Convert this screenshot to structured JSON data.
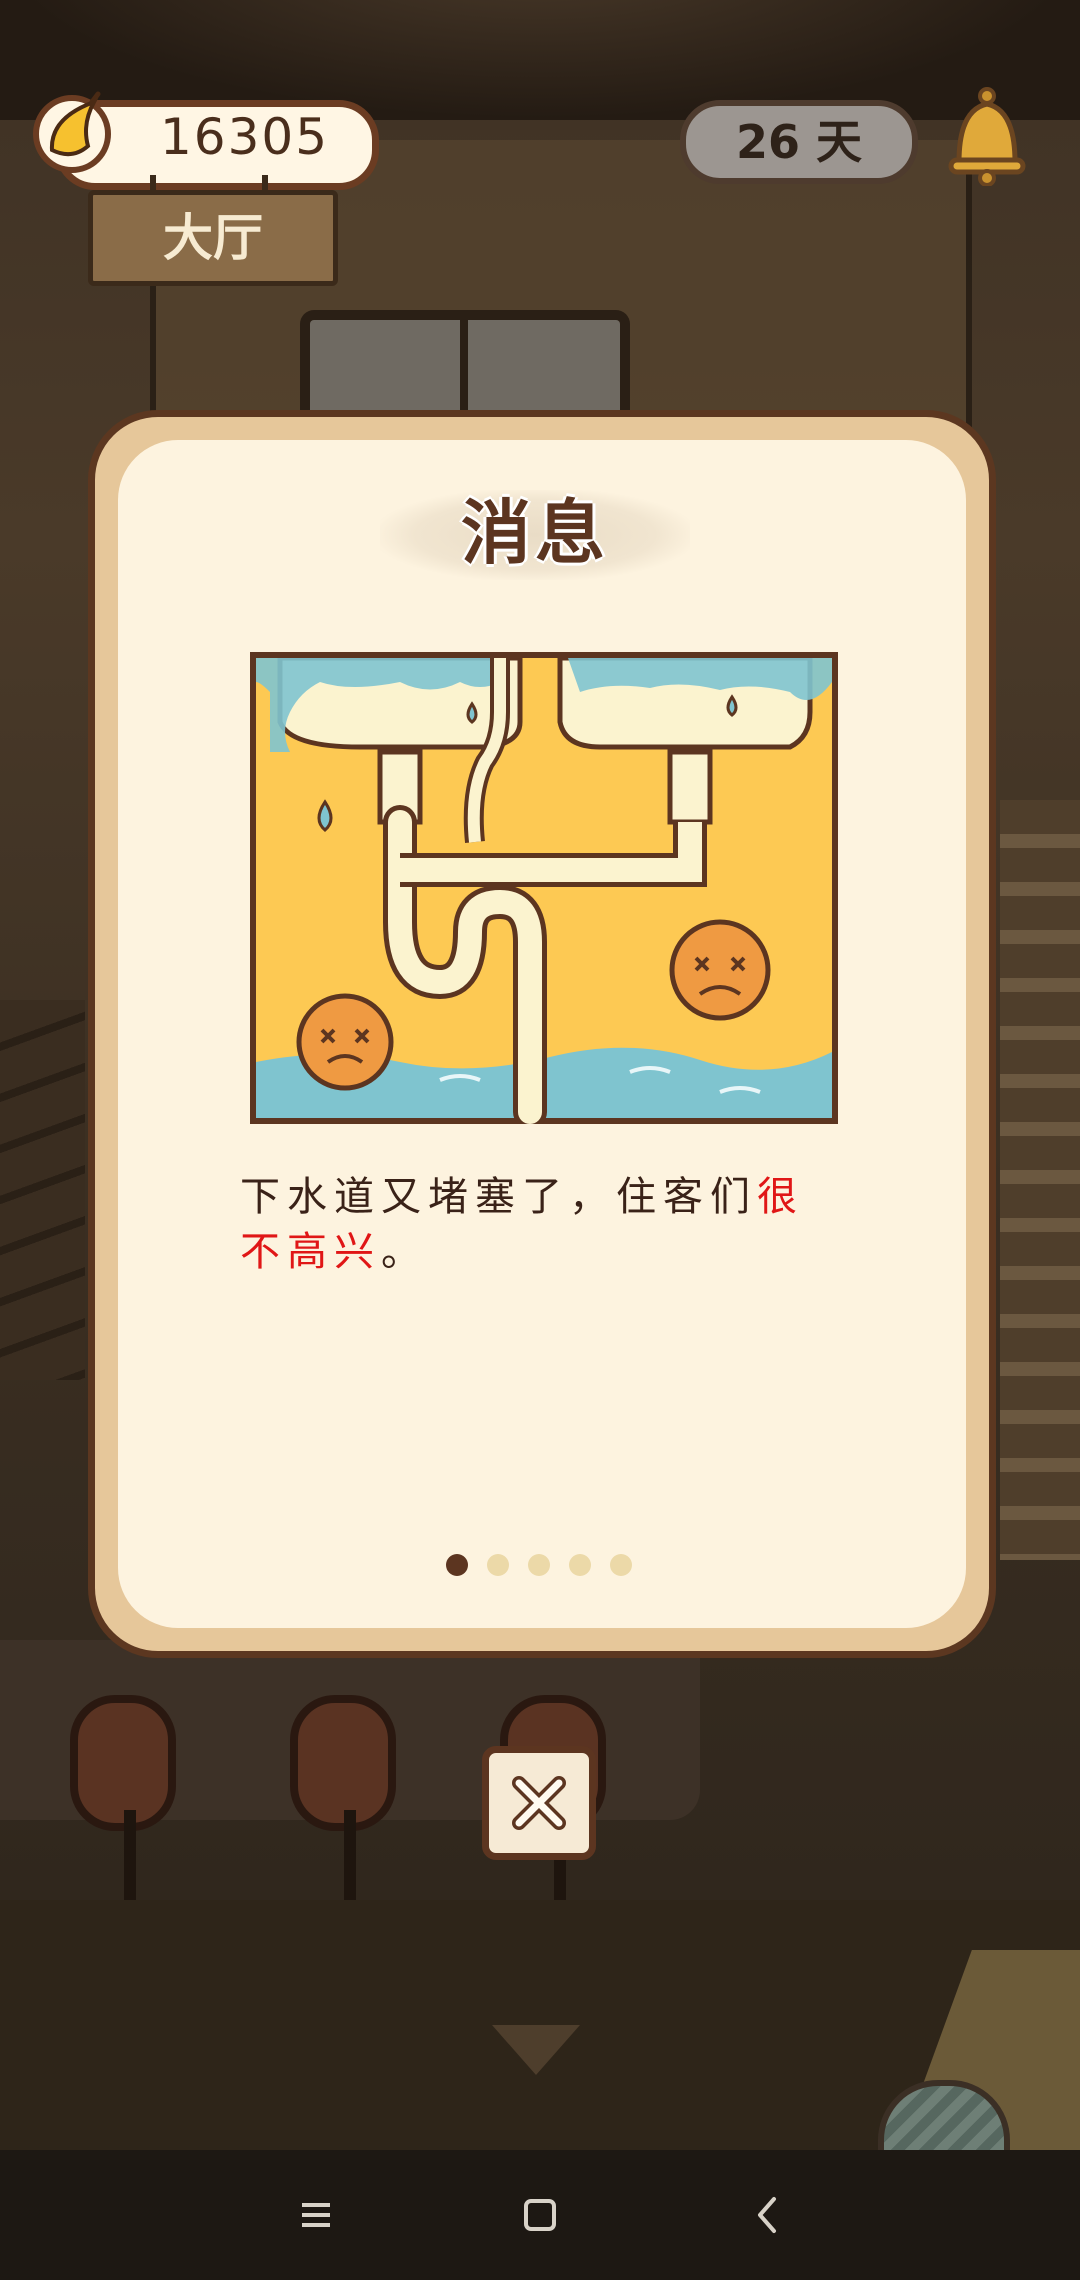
{
  "hud": {
    "banana_count": "16305",
    "room_label": "大厅",
    "days_label": "26 天"
  },
  "modal": {
    "title": "消息",
    "message_prefix": "下水道又堵塞了，住客们",
    "message_highlight": "很不高兴",
    "message_suffix": "。",
    "page_total": 5,
    "page_active": 1
  },
  "icons": {
    "banana": "banana-icon",
    "bell": "bell-icon",
    "close": "close-icon",
    "nav_menu": "menu-icon",
    "nav_home": "home-icon",
    "nav_back": "back-icon"
  },
  "colors": {
    "modal_border": "#5c3520",
    "highlight": "#e01616",
    "illustration_bg": "#fdc953",
    "water": "#7fc4cf"
  }
}
